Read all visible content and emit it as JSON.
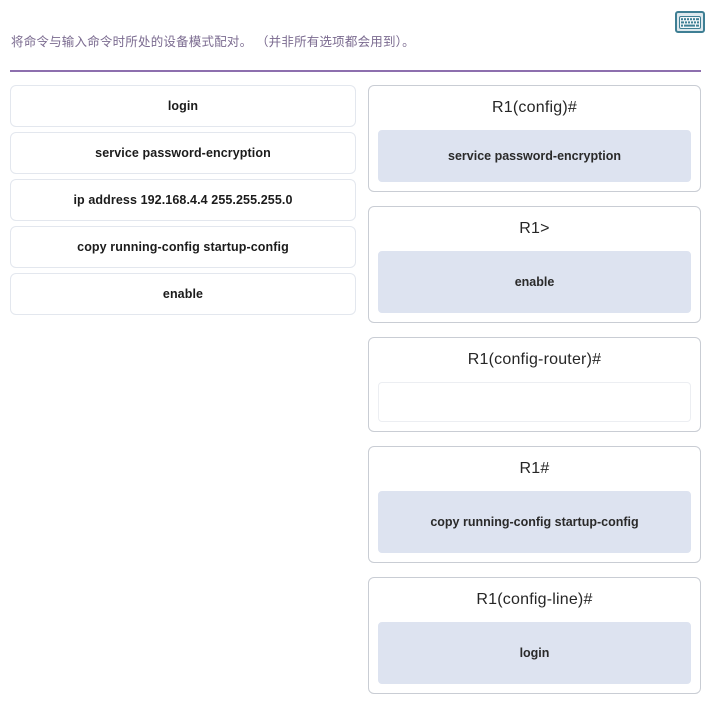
{
  "header": {
    "instruction": "将命令与输入命令时所处的设备模式配对。 （并非所有选项都会用到）。",
    "keyboard_icon": "keyboard-icon",
    "divider_color": "#8d6fae",
    "instruction_color": "#7b6b90"
  },
  "commands": [
    {
      "label": "login"
    },
    {
      "label": "service password-encryption"
    },
    {
      "label": "ip address 192.168.4.4 255.255.255.0"
    },
    {
      "label": "copy running-config startup-config"
    },
    {
      "label": "enable"
    }
  ],
  "modes": [
    {
      "prompt": "R1(config)#",
      "answer": "service password-encryption",
      "empty": false
    },
    {
      "prompt": "R1>",
      "answer": "enable",
      "empty": false
    },
    {
      "prompt": "R1(config-router)#",
      "answer": "",
      "empty": true
    },
    {
      "prompt": "R1#",
      "answer": "copy running-config startup-config",
      "empty": false
    },
    {
      "prompt": "R1(config-line)#",
      "answer": "login",
      "empty": false
    }
  ],
  "colors": {
    "dropzone_filled": "#dde3f0",
    "dropzone_empty": "#ffffff",
    "card_border": "#c9cdd4",
    "chip_border": "#e3e7ee",
    "accent_purple": "#8d6fae",
    "keyboard_icon_border": "#3f7f94"
  }
}
